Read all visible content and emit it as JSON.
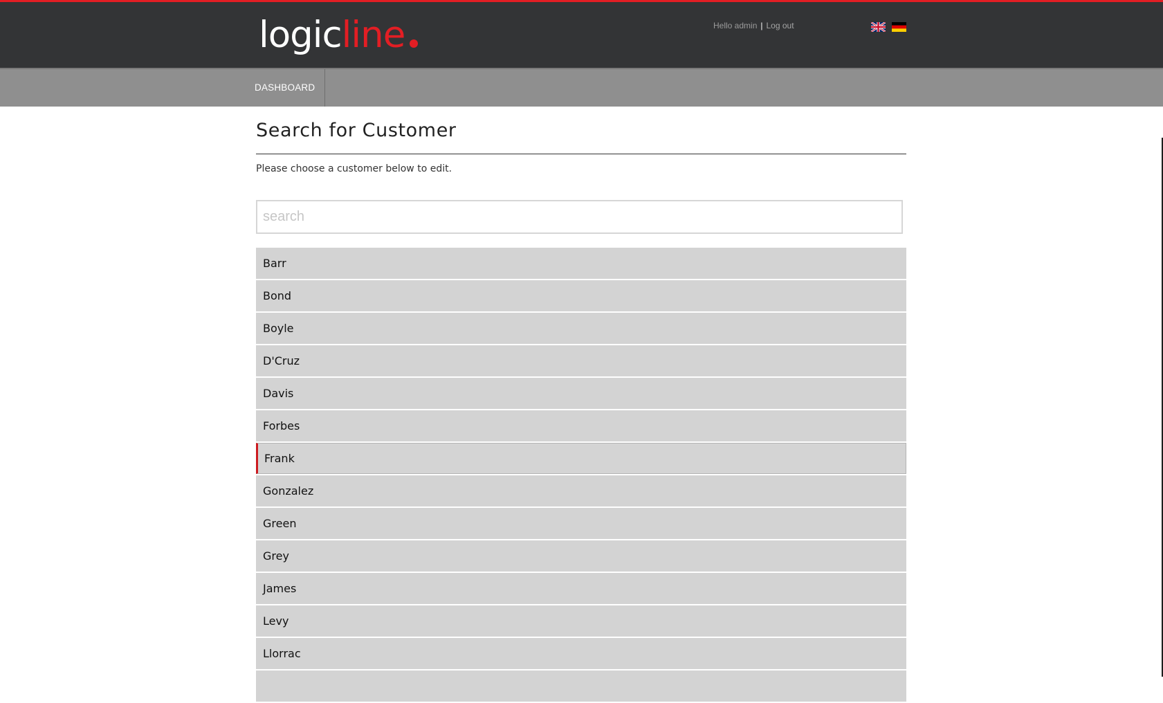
{
  "header": {
    "logo_part1": "logic",
    "logo_part2": "line",
    "greeting": "Hello admin",
    "separator": "|",
    "logout_label": "Log out",
    "flags": [
      "english-flag-icon",
      "german-flag-icon"
    ],
    "colors": {
      "accent": "#e31e24",
      "header_bg": "#333436",
      "nav_bg": "#8f8f8f",
      "list_item_bg": "#d3d3d3"
    }
  },
  "nav": {
    "items": [
      {
        "label": "DASHBOARD"
      }
    ]
  },
  "main": {
    "title": "Search for Customer",
    "intro": "Please choose a customer below to edit.",
    "search": {
      "placeholder": "search",
      "value": ""
    },
    "customers": [
      "Barr",
      "Bond",
      "Boyle",
      "D'Cruz",
      "Davis",
      "Forbes",
      "Frank",
      "Gonzalez",
      "Green",
      "Grey",
      "James",
      "Levy",
      "Llorrac",
      ""
    ],
    "active_customer": "Frank"
  }
}
